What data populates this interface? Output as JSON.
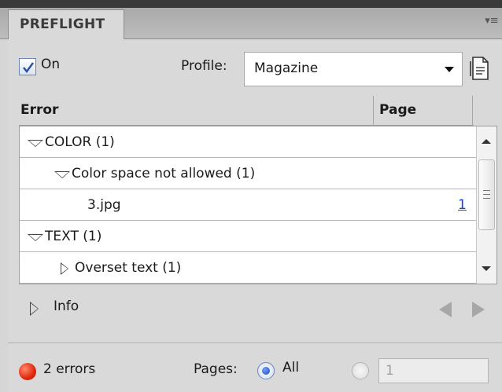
{
  "panel": {
    "tab_title": "PREFLIGHT",
    "menu_glyph": "▾≡"
  },
  "controls": {
    "on_label": "On",
    "on_checked": true,
    "profile_label": "Profile:",
    "profile_value": "Magazine"
  },
  "table": {
    "headers": [
      "Error",
      "Page"
    ],
    "rows": [
      {
        "label": "COLOR (1)",
        "expanded": true,
        "level": 0,
        "page": ""
      },
      {
        "label": "Color space not allowed (1)",
        "expanded": true,
        "level": 1,
        "page": ""
      },
      {
        "label": "3.jpg",
        "level": 2,
        "page": "1"
      },
      {
        "label": "TEXT (1)",
        "expanded": true,
        "level": 0,
        "page": ""
      },
      {
        "label": "Overset text (1)",
        "expanded": false,
        "level": 1,
        "page": ""
      }
    ]
  },
  "info": {
    "label": "Info"
  },
  "footer": {
    "errors_label": "2 errors",
    "pages_label": "Pages:",
    "all_label": "All",
    "range_value": "1"
  },
  "icons": {
    "error_dot": "red-circle-icon",
    "profile_menu": "preflight-profile-icon"
  },
  "colors": {
    "error_red": "#e2270c",
    "link_blue": "#1a3fcf"
  }
}
